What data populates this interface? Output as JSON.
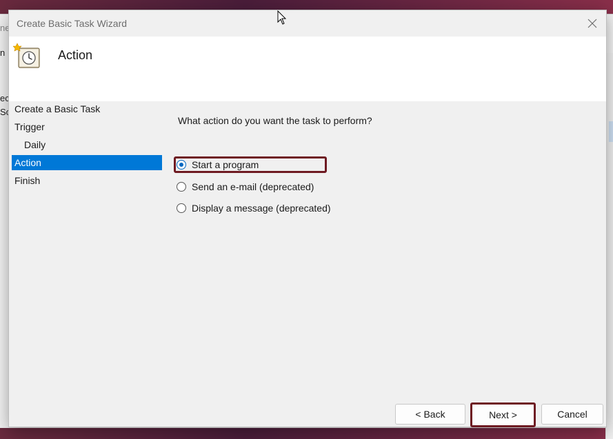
{
  "dialog": {
    "title": "Create Basic Task Wizard",
    "header_title": "Action"
  },
  "sidebar": {
    "items": [
      {
        "label": "Create a Basic Task"
      },
      {
        "label": "Trigger"
      },
      {
        "label": "Daily"
      },
      {
        "label": "Action"
      },
      {
        "label": "Finish"
      }
    ]
  },
  "main": {
    "question": "What action do you want the task to perform?",
    "options": [
      {
        "label": "Start a program",
        "checked": true
      },
      {
        "label": "Send an e-mail (deprecated)",
        "checked": false
      },
      {
        "label": "Display a message (deprecated)",
        "checked": false
      }
    ]
  },
  "buttons": {
    "back": "< Back",
    "next": "Next >",
    "cancel": "Cancel"
  },
  "background": {
    "frag1": "ne",
    "frag2": "n",
    "frag3": "ec",
    "frag4": "So"
  },
  "colors": {
    "selection": "#0078d7",
    "radio_checked": "#0067c0",
    "highlight_border": "#6e1a22"
  }
}
